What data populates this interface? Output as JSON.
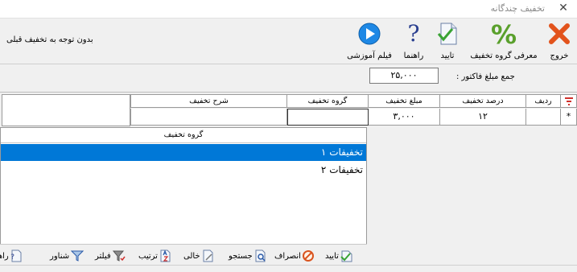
{
  "window": {
    "title": "تخفیف چندگانه",
    "close_glyph": "✕"
  },
  "toolbar": {
    "exit_label": "خروج",
    "define_group_label": "معرفی گروه تخفیف",
    "confirm_label": "تایید",
    "help_label": "راهنما",
    "video_label": "فیلم آموزشی",
    "help_glyph": "?",
    "percent_glyph": "%"
  },
  "note": "بدون توجه به تخفیف قبلی",
  "invoice_sum": {
    "label": "جمع مبلغ فاکتور :",
    "value": "۲۵,۰۰۰"
  },
  "grid": {
    "columns": {
      "row": "ردیف",
      "percent": "درصد تخفیف",
      "amount": "مبلغ تخفیف",
      "group": "گروه تخفیف",
      "description": "شرح تخفیف"
    },
    "row_marker": "*",
    "rows": [
      {
        "row": "",
        "percent": "۱۲",
        "amount": "۳,۰۰۰",
        "group": "",
        "description": ""
      }
    ]
  },
  "dropdown": {
    "header": "گروه تخفیف",
    "items": [
      "تخفیفات ۱",
      "تخفیفات ۲"
    ],
    "selected_index": 0
  },
  "bottom_toolbar": {
    "confirm": "تایید",
    "cancel": "انصراف",
    "search": "جستجو",
    "empty": "خالی",
    "sort": "ترتیب",
    "filter": "فیلتر",
    "float": "شناور",
    "help": "راهنما"
  },
  "colors": {
    "selection": "#0078d7",
    "exit_red": "#e2531c",
    "percent_green": "#5aa02c",
    "play_blue": "#1e88e5"
  }
}
